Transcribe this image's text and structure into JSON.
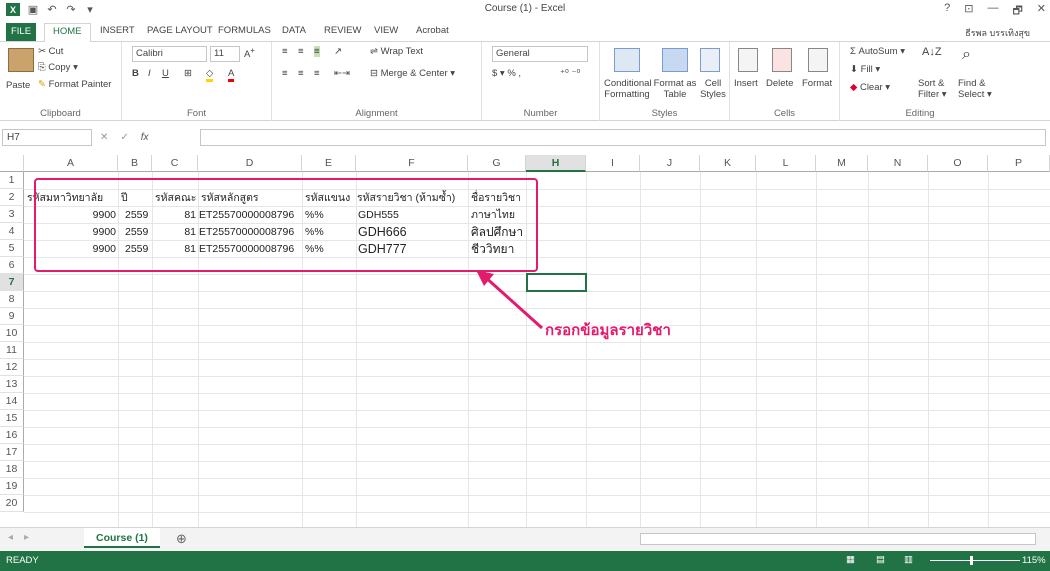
{
  "window": {
    "title": "Course (1) - Excel",
    "user": "ธีรพล บรรเทิงสุข"
  },
  "qat": {
    "help": "?",
    "restore_ribbon": "⊡",
    "minimize": "—",
    "maximize": "🗗",
    "close": "✕"
  },
  "tabs": [
    "FILE",
    "HOME",
    "INSERT",
    "PAGE LAYOUT",
    "FORMULAS",
    "DATA",
    "REVIEW",
    "VIEW",
    "Acrobat"
  ],
  "ribbon": {
    "clipboard": {
      "label": "Clipboard",
      "paste": "Paste",
      "cut": "Cut",
      "copy": "Copy",
      "format_painter": "Format Painter"
    },
    "font": {
      "label": "Font",
      "name": "Calibri",
      "size": "11"
    },
    "alignment": {
      "label": "Alignment",
      "wrap": "Wrap Text",
      "merge": "Merge & Center"
    },
    "number": {
      "label": "Number",
      "format": "General"
    },
    "styles": {
      "label": "Styles",
      "conditional": "Conditional",
      "conditional2": "Formatting",
      "format_as": "Format as",
      "format_as2": "Table",
      "cell": "Cell",
      "cell2": "Styles"
    },
    "cells": {
      "label": "Cells",
      "insert": "Insert",
      "delete": "Delete",
      "format": "Format"
    },
    "editing": {
      "label": "Editing",
      "autosum": "AutoSum",
      "fill": "Fill",
      "clear": "Clear",
      "sort": "Sort &",
      "sort2": "Filter",
      "find": "Find &",
      "find2": "Select"
    }
  },
  "formula_bar": {
    "name_box": "H7",
    "cancel": "✕",
    "enter": "✓",
    "fx": "fx",
    "value": ""
  },
  "columns": [
    "A",
    "B",
    "C",
    "D",
    "E",
    "F",
    "G",
    "H",
    "I",
    "J",
    "K",
    "L",
    "M",
    "N",
    "O",
    "P"
  ],
  "rows": [
    "1",
    "2",
    "3",
    "4",
    "5",
    "6",
    "7",
    "8",
    "9",
    "10",
    "11",
    "12",
    "13",
    "14",
    "15",
    "16",
    "17",
    "18",
    "19",
    "20"
  ],
  "cells": {
    "header": [
      "รหัสมหาวิทยาลัย",
      "ปี",
      "รหัสคณะ",
      "รหัสหลักสูตร",
      "รหัสแขนง",
      "รหัสรายวิชา (ห้ามซ้ำ)",
      "ชื่อรายวิชา"
    ],
    "data": [
      [
        "9900",
        "2559",
        "81",
        "ET25570000008796",
        "%%",
        "GDH555",
        "ภาษาไทย"
      ],
      [
        "9900",
        "2559",
        "81",
        "ET25570000008796",
        "%%",
        "GDH666",
        "ศิลปศึกษา"
      ],
      [
        "9900",
        "2559",
        "81",
        "ET25570000008796",
        "%%",
        "GDH777",
        "ชีววิทยา"
      ]
    ]
  },
  "annotation": {
    "text": "กรอกข้อมูลรายวิชา",
    "color": "#e31b6d"
  },
  "sheets": {
    "active": "Course (1)",
    "add": "⊕"
  },
  "status": {
    "mode": "READY",
    "zoom": "115%"
  },
  "colors": {
    "accent": "#217346"
  }
}
